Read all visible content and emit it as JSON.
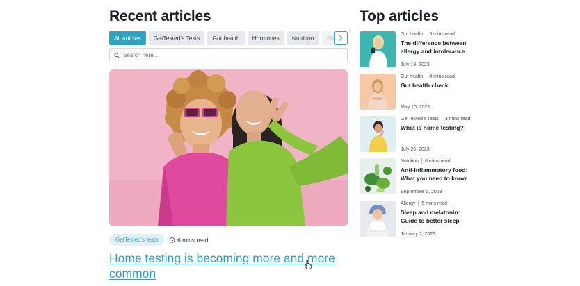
{
  "recent": {
    "heading": "Recent articles",
    "tabs": [
      {
        "label": "All articles"
      },
      {
        "label": "GetTested's Tests"
      },
      {
        "label": "Gut health"
      },
      {
        "label": "Hormones"
      },
      {
        "label": "Nutrition"
      },
      {
        "label": "Allergy"
      }
    ],
    "search_placeholder": "Search here...",
    "featured": {
      "category": "GetTested's tests",
      "read_time": "6 mins read",
      "title": "Home testing is becoming more and more common"
    }
  },
  "top": {
    "heading": "Top articles",
    "cards": [
      {
        "category": "Gut health",
        "read_time": "5 mins read",
        "title": "The difference between allergy and intolerance",
        "date": "July 18, 2023"
      },
      {
        "category": "Gut health",
        "read_time": "4 mins read",
        "title": "Gut health check",
        "date": "May 10, 2022"
      },
      {
        "category": "GetTested's Tests",
        "read_time": "3 mins read",
        "title": "What is home testing?",
        "date": "July 26, 2023"
      },
      {
        "category": "Nutrition",
        "read_time": "6 mins read",
        "title": "Anti-inflammatory food: What you need to know",
        "date": "September 5, 2023"
      },
      {
        "category": "Allergy",
        "read_time": "5 mins read",
        "title": "Sleep and melatonin: Guide to better sleep",
        "date": "January 2, 2023"
      }
    ]
  },
  "colors": {
    "accent": "#2aa3c4",
    "underline": "#f0a46a"
  },
  "icons": [
    "chevron-right-icon",
    "search-icon",
    "clock-icon",
    "hand-cursor-icon"
  ]
}
